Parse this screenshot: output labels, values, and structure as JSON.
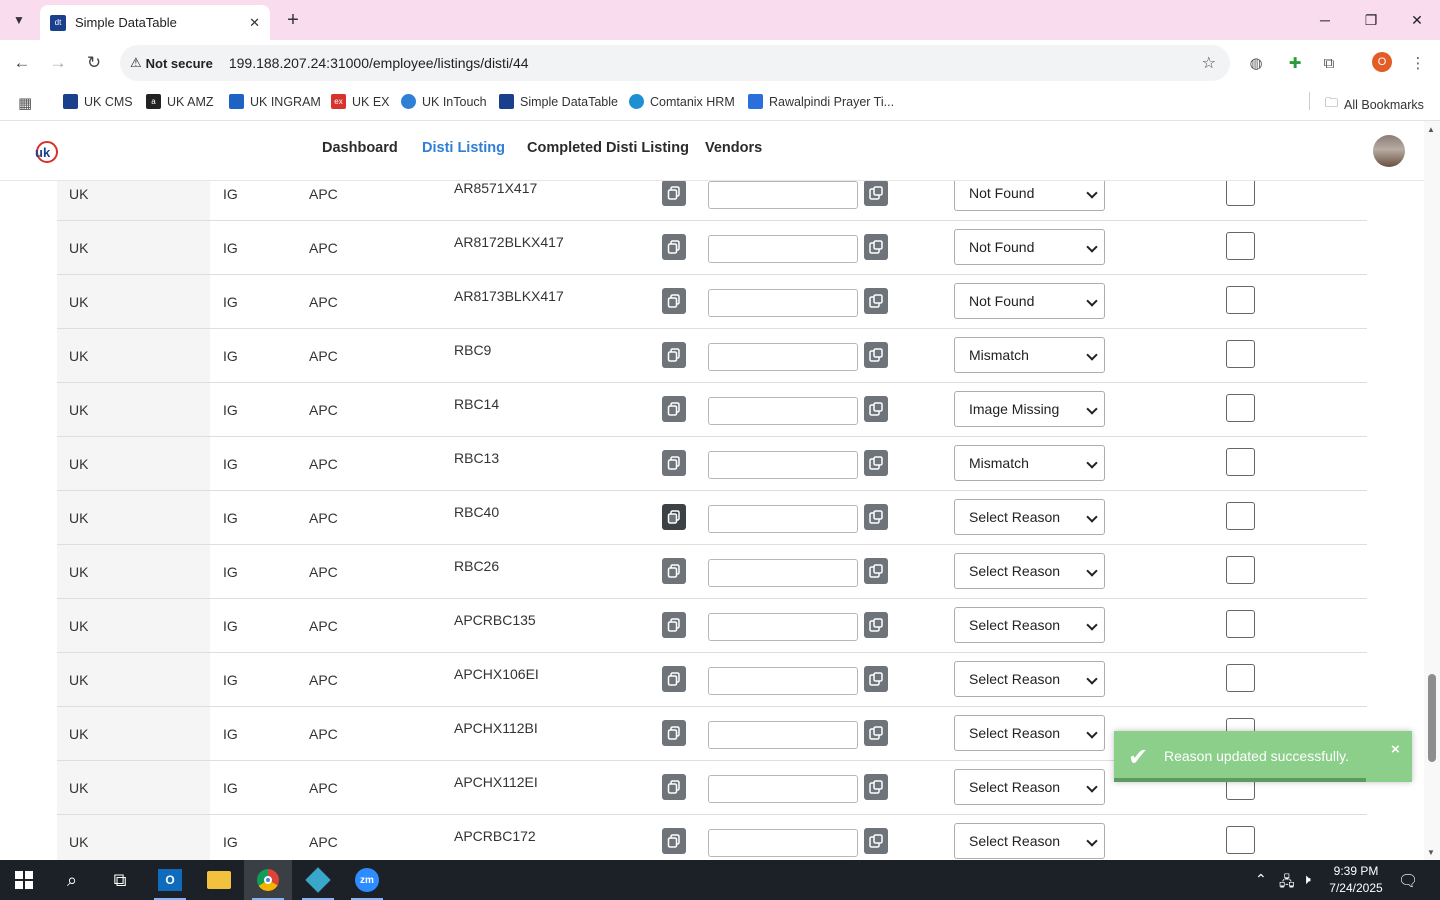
{
  "browser": {
    "tab_title": "Simple DataTable",
    "favicon_text": "dt",
    "security_label": "Not secure",
    "url": "199.188.207.24:31000/employee/listings/disti/44",
    "profile_initial": "O"
  },
  "bookmarks": [
    {
      "label": "UK CMS",
      "icon_color": "#1a3f8c"
    },
    {
      "label": "UK AMZ",
      "icon_color": "#222222"
    },
    {
      "label": "UK INGRAM",
      "icon_color": "#1e63c4"
    },
    {
      "label": "UK EX",
      "icon_color": "#d6332c"
    },
    {
      "label": "UK InTouch",
      "icon_color": "#2f7fd6"
    },
    {
      "label": "Simple DataTable",
      "icon_color": "#1a3f8c"
    },
    {
      "label": "Comtanix HRM",
      "icon_color": "#1e8fd1"
    },
    {
      "label": "Rawalpindi Prayer Ti...",
      "icon_color": "#2a6fdb"
    }
  ],
  "all_bookmarks_label": "All Bookmarks",
  "app": {
    "nav": [
      {
        "label": "Dashboard",
        "active": false
      },
      {
        "label": "Disti Listing",
        "active": true
      },
      {
        "label": "Completed Disti Listing",
        "active": false
      },
      {
        "label": "Vendors",
        "active": false
      }
    ]
  },
  "rows": [
    {
      "country": "UK",
      "distributor": "IG",
      "brand": "APC",
      "sku": "AR8571X417",
      "reason": "Not Found"
    },
    {
      "country": "UK",
      "distributor": "IG",
      "brand": "APC",
      "sku": "AR8172BLKX417",
      "reason": "Not Found"
    },
    {
      "country": "UK",
      "distributor": "IG",
      "brand": "APC",
      "sku": "AR8173BLKX417",
      "reason": "Not Found"
    },
    {
      "country": "UK",
      "distributor": "IG",
      "brand": "APC",
      "sku": "RBC9",
      "reason": "Mismatch"
    },
    {
      "country": "UK",
      "distributor": "IG",
      "brand": "APC",
      "sku": "RBC14",
      "reason": "Image Missing"
    },
    {
      "country": "UK",
      "distributor": "IG",
      "brand": "APC",
      "sku": "RBC13",
      "reason": "Mismatch"
    },
    {
      "country": "UK",
      "distributor": "IG",
      "brand": "APC",
      "sku": "RBC40",
      "reason": "Select Reason"
    },
    {
      "country": "UK",
      "distributor": "IG",
      "brand": "APC",
      "sku": "RBC26",
      "reason": "Select Reason"
    },
    {
      "country": "UK",
      "distributor": "IG",
      "brand": "APC",
      "sku": "APCRBC135",
      "reason": "Select Reason"
    },
    {
      "country": "UK",
      "distributor": "IG",
      "brand": "APC",
      "sku": "APCHX106EI",
      "reason": "Select Reason"
    },
    {
      "country": "UK",
      "distributor": "IG",
      "brand": "APC",
      "sku": "APCHX112BI",
      "reason": "Select Reason"
    },
    {
      "country": "UK",
      "distributor": "IG",
      "brand": "APC",
      "sku": "APCHX112EI",
      "reason": "Select Reason"
    },
    {
      "country": "UK",
      "distributor": "IG",
      "brand": "APC",
      "sku": "APCRBC172",
      "reason": "Select Reason"
    }
  ],
  "toast": {
    "message": "Reason updated successfully.",
    "close": "×",
    "color": "#8bcf8b"
  },
  "taskbar": {
    "time": "9:39 PM",
    "date": "7/24/2025"
  }
}
